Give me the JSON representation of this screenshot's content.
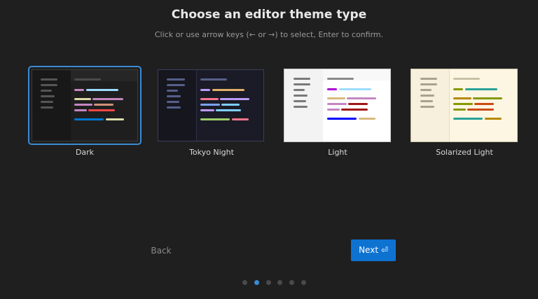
{
  "header": {
    "title": "Choose an editor theme type",
    "subtitle": "Click or use arrow keys (← or →) to select, Enter to confirm."
  },
  "themes": [
    {
      "name": "Dark",
      "selected": true
    },
    {
      "name": "Tokyo Night",
      "selected": false
    },
    {
      "name": "Light",
      "selected": false
    },
    {
      "name": "Solarized Light",
      "selected": false
    }
  ],
  "nav": {
    "back_label": "Back",
    "next_label": "Next ⏎"
  },
  "pagination": {
    "total": 6,
    "current_index": 1
  },
  "colors": {
    "background": "#1f1f1f",
    "accent": "#3b8bd4",
    "primary_button": "#0e72d1"
  }
}
